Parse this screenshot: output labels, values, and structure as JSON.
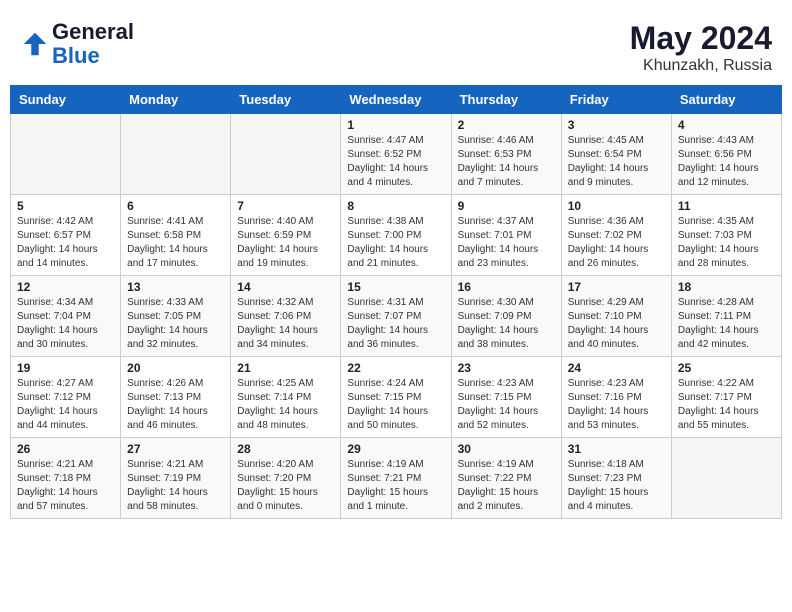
{
  "header": {
    "logo_line1": "General",
    "logo_line2": "Blue",
    "month_year": "May 2024",
    "location": "Khunzakh, Russia"
  },
  "days_of_week": [
    "Sunday",
    "Monday",
    "Tuesday",
    "Wednesday",
    "Thursday",
    "Friday",
    "Saturday"
  ],
  "weeks": [
    [
      {
        "day": "",
        "detail": ""
      },
      {
        "day": "",
        "detail": ""
      },
      {
        "day": "",
        "detail": ""
      },
      {
        "day": "1",
        "detail": "Sunrise: 4:47 AM\nSunset: 6:52 PM\nDaylight: 14 hours\nand 4 minutes."
      },
      {
        "day": "2",
        "detail": "Sunrise: 4:46 AM\nSunset: 6:53 PM\nDaylight: 14 hours\nand 7 minutes."
      },
      {
        "day": "3",
        "detail": "Sunrise: 4:45 AM\nSunset: 6:54 PM\nDaylight: 14 hours\nand 9 minutes."
      },
      {
        "day": "4",
        "detail": "Sunrise: 4:43 AM\nSunset: 6:56 PM\nDaylight: 14 hours\nand 12 minutes."
      }
    ],
    [
      {
        "day": "5",
        "detail": "Sunrise: 4:42 AM\nSunset: 6:57 PM\nDaylight: 14 hours\nand 14 minutes."
      },
      {
        "day": "6",
        "detail": "Sunrise: 4:41 AM\nSunset: 6:58 PM\nDaylight: 14 hours\nand 17 minutes."
      },
      {
        "day": "7",
        "detail": "Sunrise: 4:40 AM\nSunset: 6:59 PM\nDaylight: 14 hours\nand 19 minutes."
      },
      {
        "day": "8",
        "detail": "Sunrise: 4:38 AM\nSunset: 7:00 PM\nDaylight: 14 hours\nand 21 minutes."
      },
      {
        "day": "9",
        "detail": "Sunrise: 4:37 AM\nSunset: 7:01 PM\nDaylight: 14 hours\nand 23 minutes."
      },
      {
        "day": "10",
        "detail": "Sunrise: 4:36 AM\nSunset: 7:02 PM\nDaylight: 14 hours\nand 26 minutes."
      },
      {
        "day": "11",
        "detail": "Sunrise: 4:35 AM\nSunset: 7:03 PM\nDaylight: 14 hours\nand 28 minutes."
      }
    ],
    [
      {
        "day": "12",
        "detail": "Sunrise: 4:34 AM\nSunset: 7:04 PM\nDaylight: 14 hours\nand 30 minutes."
      },
      {
        "day": "13",
        "detail": "Sunrise: 4:33 AM\nSunset: 7:05 PM\nDaylight: 14 hours\nand 32 minutes."
      },
      {
        "day": "14",
        "detail": "Sunrise: 4:32 AM\nSunset: 7:06 PM\nDaylight: 14 hours\nand 34 minutes."
      },
      {
        "day": "15",
        "detail": "Sunrise: 4:31 AM\nSunset: 7:07 PM\nDaylight: 14 hours\nand 36 minutes."
      },
      {
        "day": "16",
        "detail": "Sunrise: 4:30 AM\nSunset: 7:09 PM\nDaylight: 14 hours\nand 38 minutes."
      },
      {
        "day": "17",
        "detail": "Sunrise: 4:29 AM\nSunset: 7:10 PM\nDaylight: 14 hours\nand 40 minutes."
      },
      {
        "day": "18",
        "detail": "Sunrise: 4:28 AM\nSunset: 7:11 PM\nDaylight: 14 hours\nand 42 minutes."
      }
    ],
    [
      {
        "day": "19",
        "detail": "Sunrise: 4:27 AM\nSunset: 7:12 PM\nDaylight: 14 hours\nand 44 minutes."
      },
      {
        "day": "20",
        "detail": "Sunrise: 4:26 AM\nSunset: 7:13 PM\nDaylight: 14 hours\nand 46 minutes."
      },
      {
        "day": "21",
        "detail": "Sunrise: 4:25 AM\nSunset: 7:14 PM\nDaylight: 14 hours\nand 48 minutes."
      },
      {
        "day": "22",
        "detail": "Sunrise: 4:24 AM\nSunset: 7:15 PM\nDaylight: 14 hours\nand 50 minutes."
      },
      {
        "day": "23",
        "detail": "Sunrise: 4:23 AM\nSunset: 7:15 PM\nDaylight: 14 hours\nand 52 minutes."
      },
      {
        "day": "24",
        "detail": "Sunrise: 4:23 AM\nSunset: 7:16 PM\nDaylight: 14 hours\nand 53 minutes."
      },
      {
        "day": "25",
        "detail": "Sunrise: 4:22 AM\nSunset: 7:17 PM\nDaylight: 14 hours\nand 55 minutes."
      }
    ],
    [
      {
        "day": "26",
        "detail": "Sunrise: 4:21 AM\nSunset: 7:18 PM\nDaylight: 14 hours\nand 57 minutes."
      },
      {
        "day": "27",
        "detail": "Sunrise: 4:21 AM\nSunset: 7:19 PM\nDaylight: 14 hours\nand 58 minutes."
      },
      {
        "day": "28",
        "detail": "Sunrise: 4:20 AM\nSunset: 7:20 PM\nDaylight: 15 hours\nand 0 minutes."
      },
      {
        "day": "29",
        "detail": "Sunrise: 4:19 AM\nSunset: 7:21 PM\nDaylight: 15 hours\nand 1 minute."
      },
      {
        "day": "30",
        "detail": "Sunrise: 4:19 AM\nSunset: 7:22 PM\nDaylight: 15 hours\nand 2 minutes."
      },
      {
        "day": "31",
        "detail": "Sunrise: 4:18 AM\nSunset: 7:23 PM\nDaylight: 15 hours\nand 4 minutes."
      },
      {
        "day": "",
        "detail": ""
      }
    ]
  ]
}
